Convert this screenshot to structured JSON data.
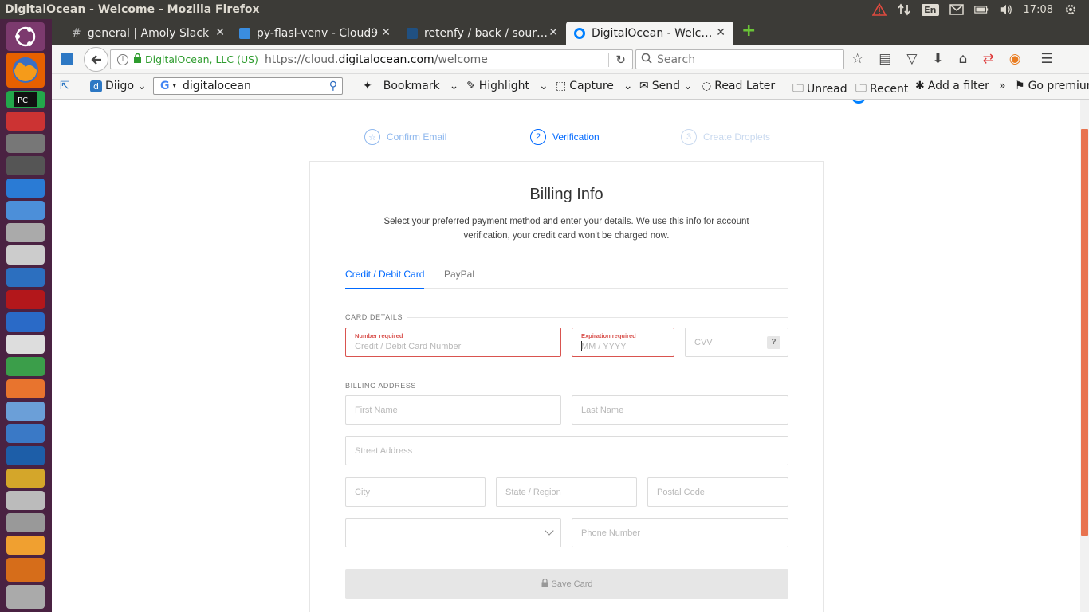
{
  "os": {
    "window_title": "DigitalOcean - Welcome - Mozilla Firefox",
    "lang": "En",
    "time": "17:08"
  },
  "browser": {
    "tabs": [
      {
        "label": "general | Amoly Slack",
        "icon": "slack-hash-icon"
      },
      {
        "label": "py-flasl-venv - Cloud9",
        "icon": "cloud9-icon"
      },
      {
        "label": "retenfy / back / sour…",
        "icon": "bitbucket-icon"
      },
      {
        "label": "DigitalOcean - Welc…",
        "icon": "digitalocean-icon"
      }
    ],
    "identity": "DigitalOcean, LLC (US)",
    "url_prefix": "https://cloud.",
    "url_domain": "digitalocean.com",
    "url_path": "/welcome",
    "search_placeholder": "Search"
  },
  "diigo": {
    "brand": "Diigo",
    "search_value": "digitalocean",
    "bookmark": "Bookmark",
    "highlight": "Highlight",
    "capture": "Capture",
    "send": "Send",
    "read_later": "Read Later",
    "unread": "Unread",
    "recent": "Recent",
    "add_filter": "Add a filter",
    "more": "»",
    "go_premium": "Go premium"
  },
  "steps": [
    {
      "num": "",
      "label": "Confirm Email"
    },
    {
      "num": "2",
      "label": "Verification"
    },
    {
      "num": "3",
      "label": "Create Droplets"
    }
  ],
  "billing": {
    "title": "Billing Info",
    "subtitle_1": "Select your preferred payment method and enter your details. We use this info for account",
    "subtitle_2": "verification, your credit card won't be charged now.",
    "tab_card": "Credit / Debit Card",
    "tab_paypal": "PayPal",
    "card_details": "CARD DETAILS",
    "number_error": "Number required",
    "number_placeholder": "Credit / Debit Card Number",
    "expiry_error": "Expiration required",
    "expiry_placeholder": "MM / YYYY",
    "cvv_placeholder": "CVV",
    "cvv_help": "?",
    "billing_address": "BILLING ADDRESS",
    "first_name": "First Name",
    "last_name": "Last Name",
    "street": "Street Address",
    "city": "City",
    "state": "State / Region",
    "postal": "Postal Code",
    "country": "",
    "phone": "Phone Number",
    "save": "Save Card"
  },
  "colors": {
    "accent": "#0069ff",
    "error": "#d9534f",
    "secure_green": "#2e9c2e"
  }
}
